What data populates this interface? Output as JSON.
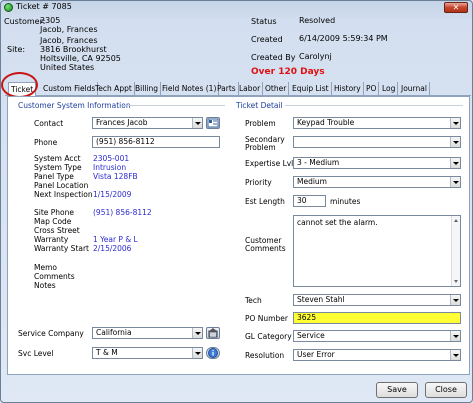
{
  "window": {
    "title": "Ticket # 7085",
    "close_glyph": "✕"
  },
  "header": {
    "customer_label": "Customer:",
    "customer_id": "2305",
    "customer_name": "Jacob, Frances",
    "site_label": "Site:",
    "site_name": "Jacob, Frances",
    "site_address1": "3816 Brookhurst",
    "site_address2": "Holtsville, CA  92505",
    "site_country": "United States",
    "status_label": "Status",
    "status_value": "Resolved",
    "created_label": "Created",
    "created_value": "6/14/2009 5:59:34 PM",
    "created_by_label": "Created By",
    "created_by_value": "Carolynj",
    "overdue": "Over 120 Days"
  },
  "tabs": [
    "Ticket",
    "Custom Fields",
    "Tech Appt",
    "Billing",
    "Field Notes (1)",
    "Parts",
    "Labor",
    "Other",
    "Equip List",
    "History",
    "PO",
    "Log",
    "Journal"
  ],
  "left": {
    "section_title": "Customer System Information",
    "contact_label": "Contact",
    "contact_value": "Frances Jacob",
    "phone_label": "Phone",
    "phone_value": "(951) 856-8112",
    "system_acct_label": "System Acct",
    "system_acct_value": "2305-001",
    "system_type_label": "System Type",
    "system_type_value": "Intrusion",
    "panel_type_label": "Panel Type",
    "panel_type_value": "Vista 128FB",
    "panel_location_label": "Panel Location",
    "next_inspection_label": "Next Inspection",
    "next_inspection_value": "1/15/2009",
    "site_phone_label": "Site Phone",
    "site_phone_value": "(951) 856-8112",
    "map_code_label": "Map Code",
    "cross_street_label": "Cross Street",
    "warranty_label": "Warranty",
    "warranty_value": "1 Year P & L",
    "warranty_start_label": "Warranty Start",
    "warranty_start_value": "2/15/2006",
    "memo_label": "Memo",
    "comments_label": "Comments",
    "notes_label": "Notes",
    "service_company_label": "Service Company",
    "service_company_value": "California",
    "svc_level_label": "Svc Level",
    "svc_level_value": "T & M"
  },
  "right": {
    "section_title": "Ticket Detail",
    "problem_label": "Problem",
    "problem_value": "Keypad Trouble",
    "secondary_problem_label1": "Secondary",
    "secondary_problem_label2": "Problem",
    "secondary_problem_value": "",
    "expertise_label": "Expertise Lvl",
    "expertise_value": "3 - Medium",
    "priority_label": "Priority",
    "priority_value": "Medium",
    "est_length_label": "Est Length",
    "est_length_value": "30",
    "est_length_unit": "minutes",
    "customer_comments_label1": "Customer",
    "customer_comments_label2": "Comments",
    "customer_comments_value": "cannot set the alarm.",
    "tech_label": "Tech",
    "tech_value": "Steven Stahl",
    "po_number_label": "PO Number",
    "po_number_value": "3625",
    "gl_category_label": "GL Category",
    "gl_category_value": "Service",
    "resolution_label": "Resolution",
    "resolution_value": "User Error"
  },
  "footer": {
    "save_label": "Save",
    "close_label": "Close"
  },
  "colors": {
    "overdue": "#e01010",
    "section_title": "#1e3e9e",
    "link_value": "#2a2ad0",
    "po_highlight": "#ffff33"
  }
}
